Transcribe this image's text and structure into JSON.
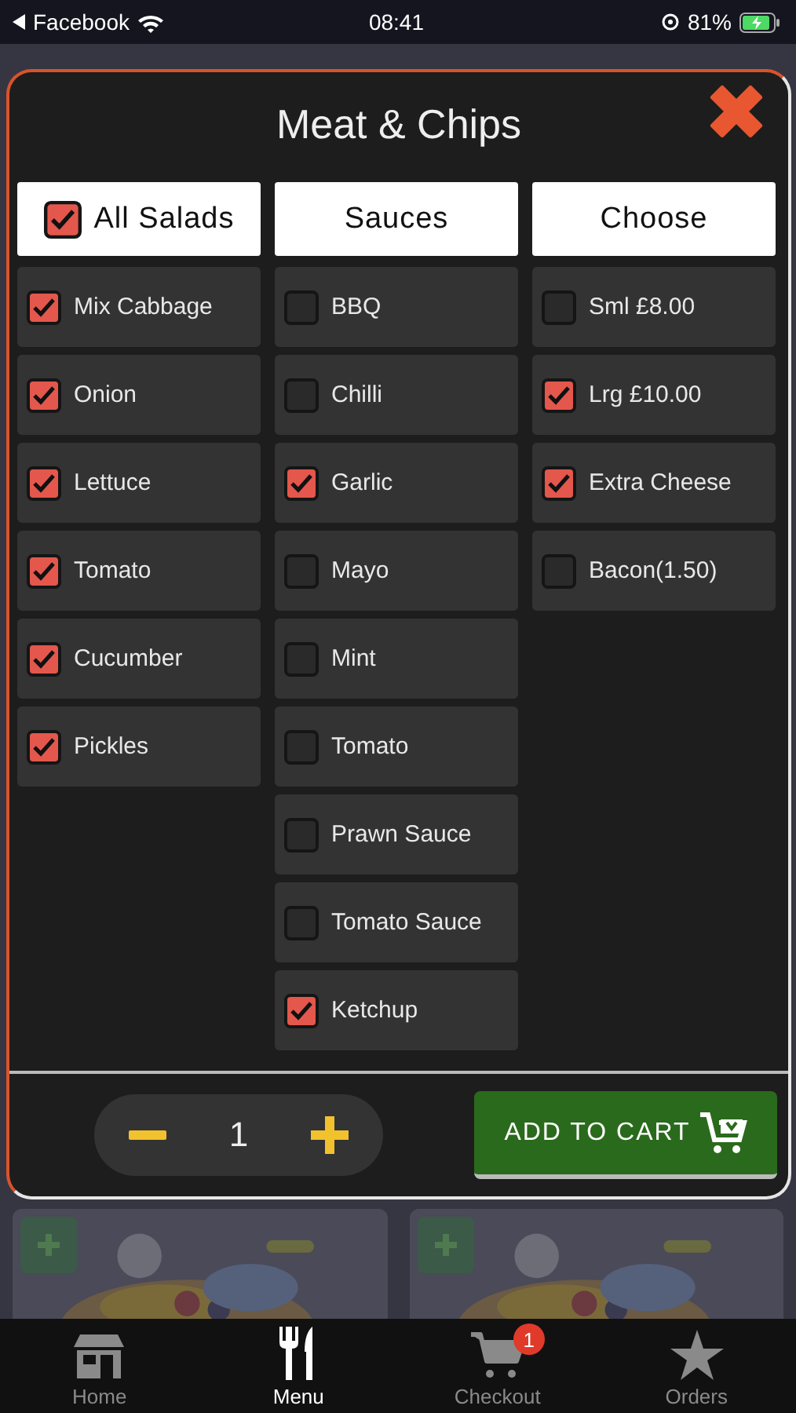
{
  "status_bar": {
    "back_app": "Facebook",
    "time": "08:41",
    "battery": "81%"
  },
  "dialog": {
    "title": "Meat & Chips",
    "columns": [
      {
        "header": {
          "label": "All Salads",
          "checked": true
        },
        "options": [
          {
            "label": "Mix Cabbage",
            "checked": true
          },
          {
            "label": "Onion",
            "checked": true
          },
          {
            "label": "Lettuce",
            "checked": true
          },
          {
            "label": "Tomato",
            "checked": true
          },
          {
            "label": "Cucumber",
            "checked": true
          },
          {
            "label": "Pickles",
            "checked": true
          }
        ]
      },
      {
        "header": {
          "label": "Sauces"
        },
        "options": [
          {
            "label": "BBQ",
            "checked": false
          },
          {
            "label": "Chilli",
            "checked": false
          },
          {
            "label": "Garlic",
            "checked": true
          },
          {
            "label": "Mayo",
            "checked": false
          },
          {
            "label": "Mint",
            "checked": false
          },
          {
            "label": "Tomato",
            "checked": false
          },
          {
            "label": "Prawn Sauce",
            "checked": false
          },
          {
            "label": "Tomato Sauce",
            "checked": false
          },
          {
            "label": "Ketchup",
            "checked": true
          }
        ]
      },
      {
        "header": {
          "label": "Choose"
        },
        "options": [
          {
            "label": "Sml £8.00",
            "checked": false
          },
          {
            "label": "Lrg £10.00",
            "checked": true
          },
          {
            "label": "Extra Cheese",
            "checked": true
          },
          {
            "label": "Bacon(1.50)",
            "checked": false
          }
        ]
      }
    ],
    "quantity": "1",
    "add_button": "ADD TO CART"
  },
  "tab_bar": [
    {
      "label": "Home",
      "selected": false
    },
    {
      "label": "Menu",
      "selected": true
    },
    {
      "label": "Checkout",
      "selected": false,
      "badge": "1"
    },
    {
      "label": "Orders",
      "selected": false
    }
  ]
}
